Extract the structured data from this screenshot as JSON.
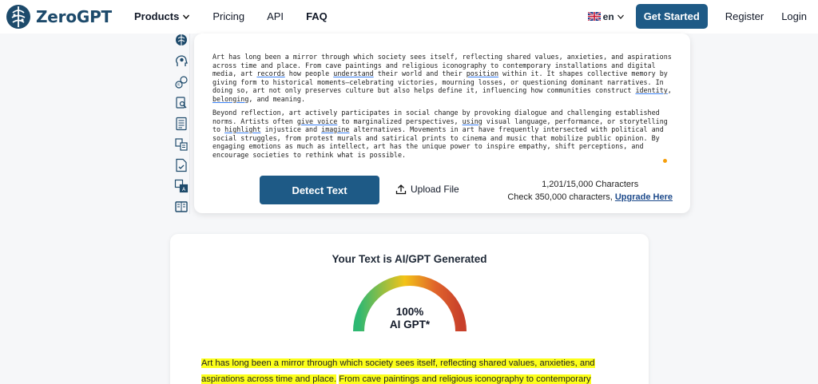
{
  "header": {
    "brand": "ZeroGPT",
    "nav": [
      {
        "label": "Products"
      },
      {
        "label": "Pricing"
      },
      {
        "label": "API"
      },
      {
        "label": "FAQ"
      }
    ],
    "language": "en",
    "get_started": "Get Started",
    "register": "Register",
    "login": "Login"
  },
  "rail": {
    "icons": [
      "brain-icon",
      "head-ai-icon",
      "ai-chat-icon",
      "document-search-icon",
      "document-lines-icon",
      "grammar-icon",
      "document-check-icon",
      "translate-icon",
      "book-icon"
    ]
  },
  "input": {
    "paragraph1": {
      "p1": "Art has long been a mirror through which society sees itself, reflecting shared values, anxieties, and aspirations across time and place. From cave paintings and religious iconography to contemporary installations and digital media, art ",
      "u1": "records",
      "p2": " how people ",
      "u2": "understand",
      "p3": " their world and their ",
      "u3": "position",
      "p4": " within it. It shapes collective memory by giving form to historical moments—celebrating victories, mourning losses, or questioning dominant narratives. In doing so, art not only preserves culture but also helps define it, influencing how communities construct ",
      "u4": "identity",
      "p5": ", ",
      "u5": "belonging",
      "p6": ", and meaning."
    },
    "paragraph2": {
      "p1": "Beyond reflection, art actively participates in social change by provoking dialogue and challenging established norms. Artists often ",
      "u1": "give voice",
      "p2": " to marginalized perspectives, ",
      "u2": "using",
      "p3": " visual language, performance, or storytelling to ",
      "u3": "highlight",
      "p4": " injustice and ",
      "u4": "imagine",
      "p5": " alternatives. Movements in art have frequently intersected with political and social struggles, from protest murals and satirical prints to cinema and music that mobilize public opinion. By engaging emotions as much as intellect, art has the unique power to inspire empathy, shift perceptions, and encourage societies to rethink what is possible."
    },
    "detect_label": "Detect Text",
    "upload_label": "Upload File",
    "char_count": "1,201/15,000 Characters",
    "check_text": "Check 350,000 characters, ",
    "upgrade_label": "Upgrade Here"
  },
  "result": {
    "title": "Your Text is AI/GPT Generated",
    "percent": "100%",
    "verdict": "AI GPT*",
    "percent_value": 100,
    "gauge_colors": [
      "#2eb872",
      "#f2c318",
      "#e0642b",
      "#c8402b"
    ],
    "highlight_color": "#fcff1a",
    "highlight_segments": [
      "Art has long been a mirror through which society sees itself, reflecting shared values, anxieties, and aspirations across time and place.",
      "From cave paintings and religious iconography to contemporary"
    ]
  },
  "colors": {
    "brand": "#1d4a6b",
    "button": "#1e5a86",
    "underline": "#3b82f6"
  }
}
